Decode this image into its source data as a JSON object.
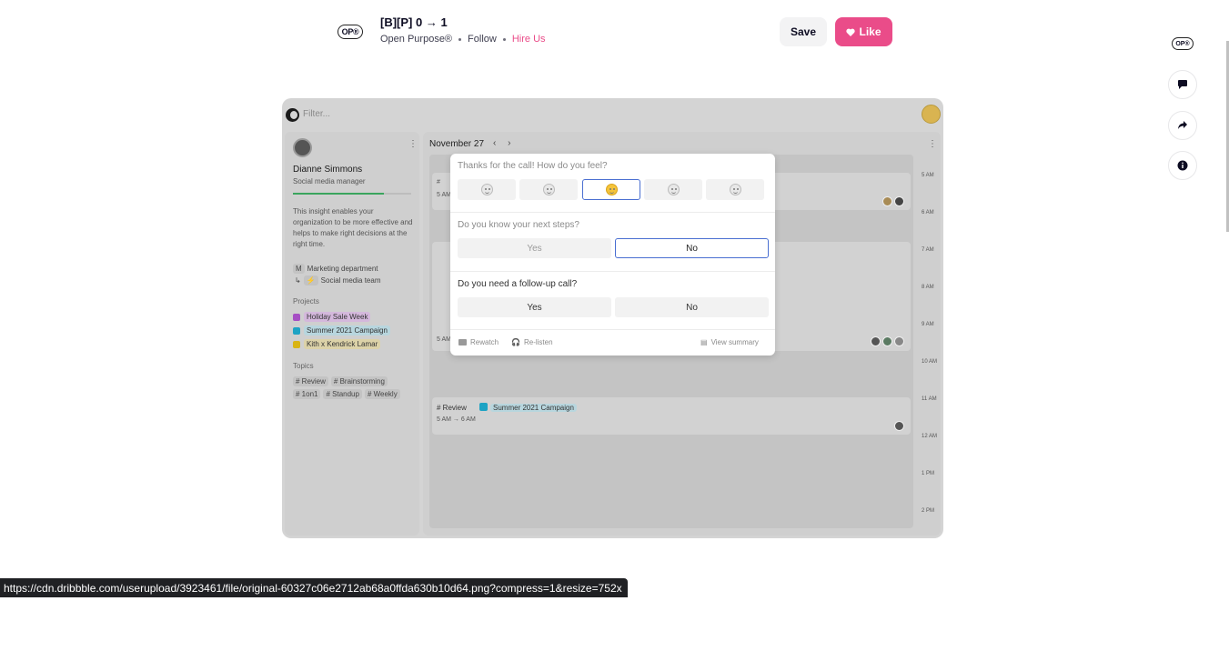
{
  "header": {
    "logo_text": "OP®",
    "shot_title": "[B][P] 0 → 1",
    "author": "Open Purpose®",
    "follow_label": "Follow",
    "hire_label": "Hire Us",
    "save_label": "Save",
    "like_label": "Like",
    "like_icon": "heart-icon",
    "accent_color": "#ea4c89"
  },
  "rail": {
    "logo_text": "OP®",
    "icons": [
      "comment-icon",
      "share-icon",
      "info-icon"
    ]
  },
  "app": {
    "filter_placeholder": "Filter...",
    "profile": {
      "name": "Dianne Simmons",
      "role": "Social media manager",
      "progress": 0.77,
      "description": "This insight enables your organization to be more effective and helps to make right decisions at the right time.",
      "department_prefix": "M",
      "department": "Marketing department",
      "team_prefix": "⚡",
      "team": "Social media team"
    },
    "projects_heading": "Projects",
    "projects": [
      {
        "label": "Holiday Sale Week",
        "color": "#a64fc4"
      },
      {
        "label": "Summer 2021 Campaign",
        "color": "#1ea3c4"
      },
      {
        "label": "Kith x Kendrick Lamar",
        "color": "#d9b414"
      }
    ],
    "topics_heading": "Topics",
    "topics": [
      "Review",
      "Brainstorming",
      "1on1",
      "Standup",
      "Weekly"
    ],
    "calendar": {
      "date": "November 27",
      "nav": "‹ ›",
      "hours": [
        "5 AM",
        "6 AM",
        "7 AM",
        "8 AM",
        "9 AM",
        "10 AM",
        "11 AM",
        "12 AM",
        "1 PM",
        "2 PM"
      ],
      "event_time_short": "5 AM",
      "event_hash": "#",
      "event_tag": "Review",
      "event_project": "Summer 2021 Campaign",
      "event_time": "5 AM → 6 AM"
    },
    "modal": {
      "q1": "Thanks for the call! How do you feel?",
      "q2": "Do you know your next steps?",
      "q2_yes": "Yes",
      "q2_no": "No",
      "q3": "Do you need a follow-up call?",
      "q3_yes": "Yes",
      "q3_no": "No",
      "rewatch": "Rewatch",
      "relisten": "Re-listen",
      "view_summary": "View summary"
    }
  },
  "status_url": "https://cdn.dribbble.com/userupload/3923461/file/original-60327c06e2712ab68a0ffda630b10d64.png?compress=1&resize=752x"
}
